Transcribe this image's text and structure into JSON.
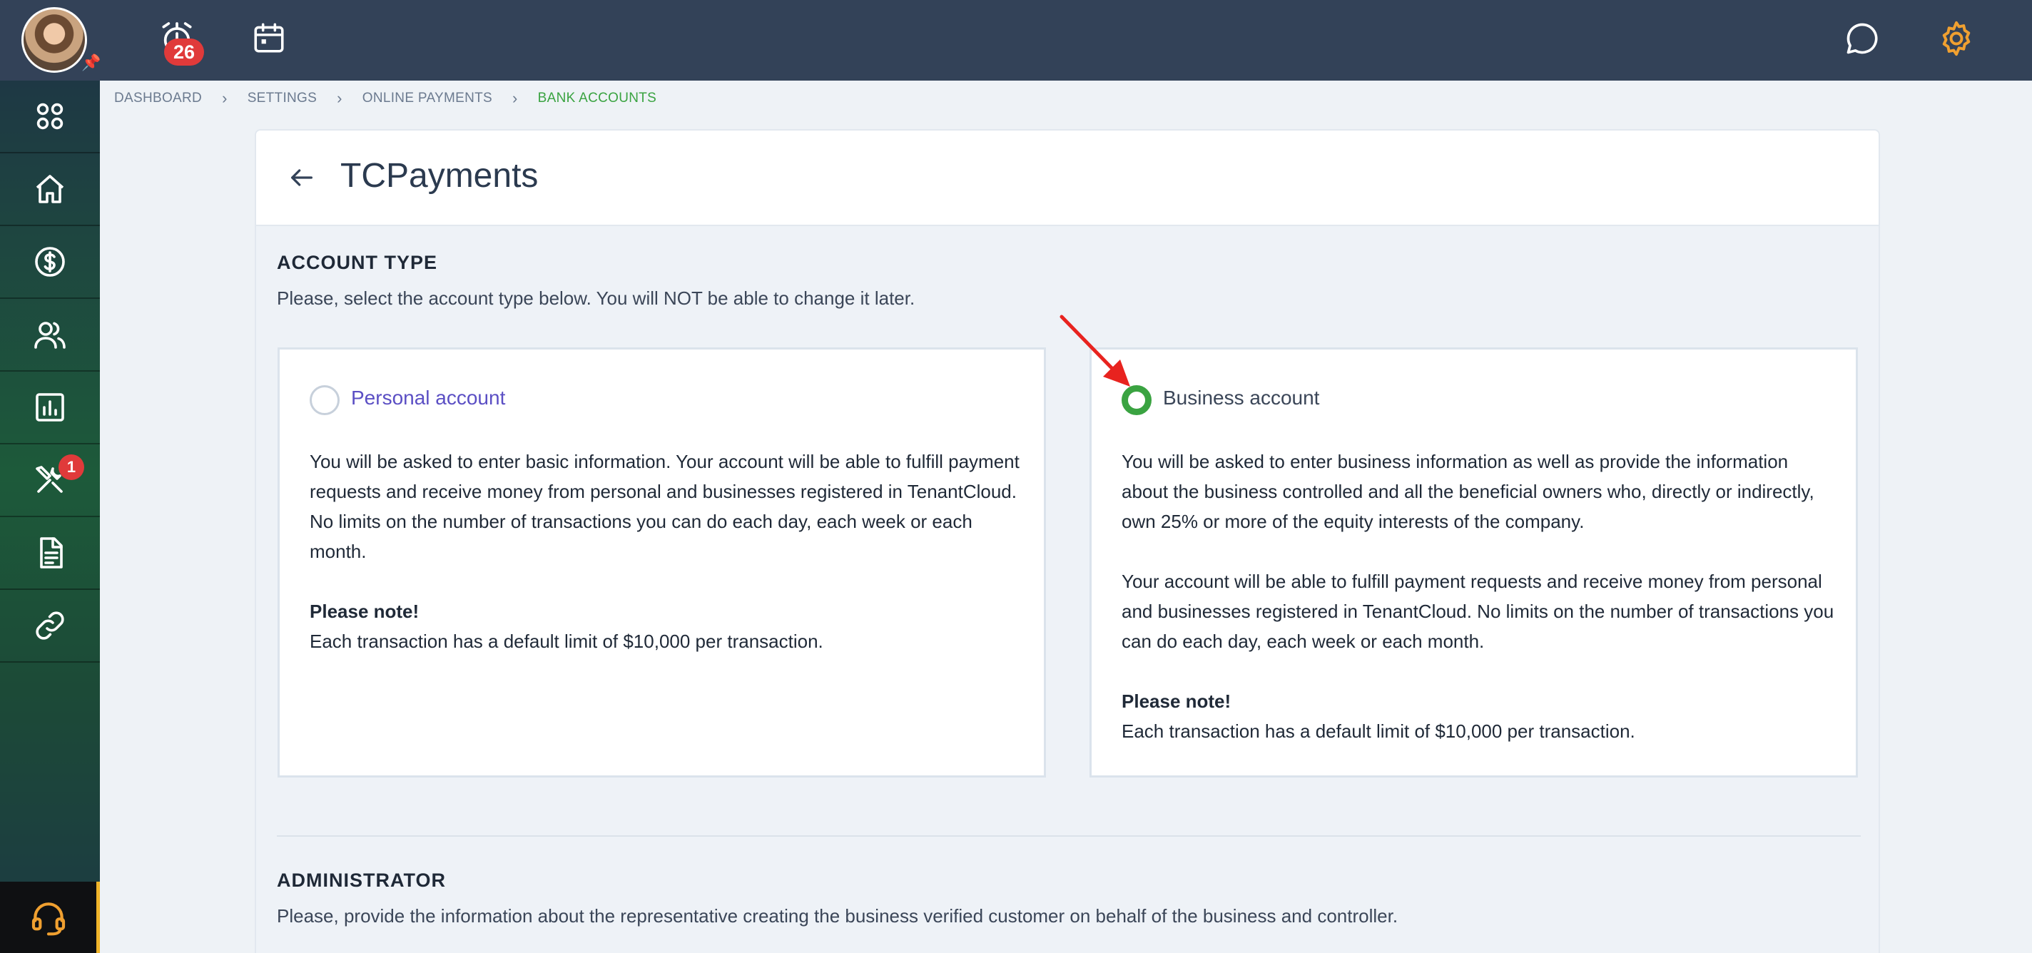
{
  "topbar": {
    "notification_count": "26"
  },
  "sidebar": {
    "items": [
      {
        "icon": "apps-grid-icon"
      },
      {
        "icon": "home-icon"
      },
      {
        "icon": "dollar-icon"
      },
      {
        "icon": "users-icon"
      },
      {
        "icon": "reports-icon"
      },
      {
        "icon": "maintenance-tools-icon",
        "badge": "1"
      },
      {
        "icon": "document-icon"
      },
      {
        "icon": "link-icon"
      }
    ]
  },
  "breadcrumb": {
    "items": [
      "DASHBOARD",
      "SETTINGS",
      "ONLINE PAYMENTS",
      "BANK ACCOUNTS"
    ]
  },
  "page": {
    "title": "TCPayments"
  },
  "account_type": {
    "title": "ACCOUNT TYPE",
    "description": "Please, select the account type below. You will NOT be able to change it later.",
    "options": [
      {
        "label": "Personal account",
        "selected": false,
        "paragraphs": [
          "You will be asked to enter basic information. Your account will be able to fulfill payment requests and receive money from personal and businesses registered in TenantCloud. No limits on the number of transactions you can do each day, each week or each month."
        ],
        "note_title": "Please note!",
        "note_text": "Each transaction has a default limit of $10,000 per transaction."
      },
      {
        "label": "Business account",
        "selected": true,
        "paragraphs": [
          "You will be asked to enter business information as well as provide the information about the business controlled and all the beneficial owners who, directly or indirectly, own 25% or more of the equity interests of the company.",
          "Your account will be able to fulfill payment requests and receive money from personal and businesses registered in TenantCloud. No limits on the number of transactions you can do each day, each week or each month."
        ],
        "note_title": "Please note!",
        "note_text": "Each transaction has a default limit of $10,000 per transaction."
      }
    ]
  },
  "administrator": {
    "title": "ADMINISTRATOR",
    "description": "Please, provide the information about the representative creating the business verified customer on behalf of the business and controller."
  },
  "colors": {
    "topbar": "#334258",
    "accent_green": "#3aa341",
    "badge_red": "#e03a3a",
    "gear_orange": "#f0a030",
    "personal_label": "#5b4fc4"
  }
}
